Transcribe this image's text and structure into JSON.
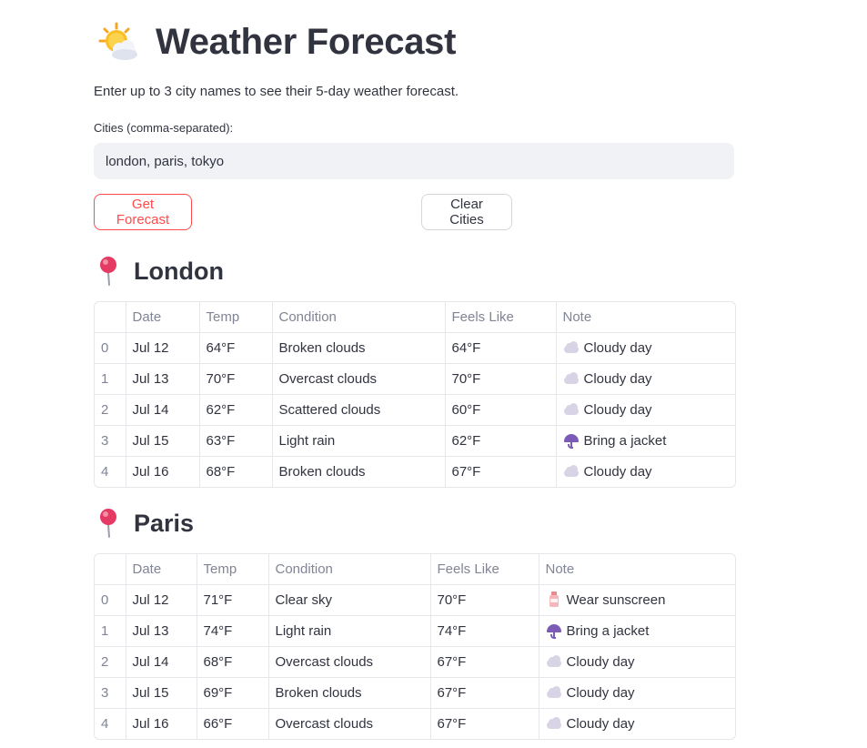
{
  "header": {
    "title": "Weather Forecast",
    "title_icon": "sun-behind-cloud-icon",
    "subtitle": "Enter up to 3 city names to see their 5-day weather forecast."
  },
  "input": {
    "label": "Cities (comma-separated):",
    "value": "london, paris, tokyo"
  },
  "buttons": {
    "get_forecast": "Get Forecast",
    "clear_cities": "Clear Cities"
  },
  "colors": {
    "primary": "#ff4b4b",
    "input_bg": "#f0f2f6",
    "text": "#31333f",
    "muted": "#808495"
  },
  "columns": [
    "",
    "Date",
    "Temp",
    "Condition",
    "Feels Like",
    "Note"
  ],
  "cities": [
    {
      "name": "London",
      "icon": "round-pushpin-icon",
      "rows": [
        {
          "index": "0",
          "date": "Jul 12",
          "temp": "64°F",
          "condition": "Broken clouds",
          "feels_like": "64°F",
          "note_icon": "cloud-icon",
          "note": "Cloudy day"
        },
        {
          "index": "1",
          "date": "Jul 13",
          "temp": "70°F",
          "condition": "Overcast clouds",
          "feels_like": "70°F",
          "note_icon": "cloud-icon",
          "note": "Cloudy day"
        },
        {
          "index": "2",
          "date": "Jul 14",
          "temp": "62°F",
          "condition": "Scattered clouds",
          "feels_like": "60°F",
          "note_icon": "cloud-icon",
          "note": "Cloudy day"
        },
        {
          "index": "3",
          "date": "Jul 15",
          "temp": "63°F",
          "condition": "Light rain",
          "feels_like": "62°F",
          "note_icon": "umbrella-icon",
          "note": "Bring a jacket"
        },
        {
          "index": "4",
          "date": "Jul 16",
          "temp": "68°F",
          "condition": "Broken clouds",
          "feels_like": "67°F",
          "note_icon": "cloud-icon",
          "note": "Cloudy day"
        }
      ]
    },
    {
      "name": "Paris",
      "icon": "round-pushpin-icon",
      "rows": [
        {
          "index": "0",
          "date": "Jul 12",
          "temp": "71°F",
          "condition": "Clear sky",
          "feels_like": "70°F",
          "note_icon": "sunscreen-icon",
          "note": "Wear sunscreen"
        },
        {
          "index": "1",
          "date": "Jul 13",
          "temp": "74°F",
          "condition": "Light rain",
          "feels_like": "74°F",
          "note_icon": "umbrella-icon",
          "note": "Bring a jacket"
        },
        {
          "index": "2",
          "date": "Jul 14",
          "temp": "68°F",
          "condition": "Overcast clouds",
          "feels_like": "67°F",
          "note_icon": "cloud-icon",
          "note": "Cloudy day"
        },
        {
          "index": "3",
          "date": "Jul 15",
          "temp": "69°F",
          "condition": "Broken clouds",
          "feels_like": "67°F",
          "note_icon": "cloud-icon",
          "note": "Cloudy day"
        },
        {
          "index": "4",
          "date": "Jul 16",
          "temp": "66°F",
          "condition": "Overcast clouds",
          "feels_like": "67°F",
          "note_icon": "cloud-icon",
          "note": "Cloudy day"
        }
      ]
    }
  ]
}
